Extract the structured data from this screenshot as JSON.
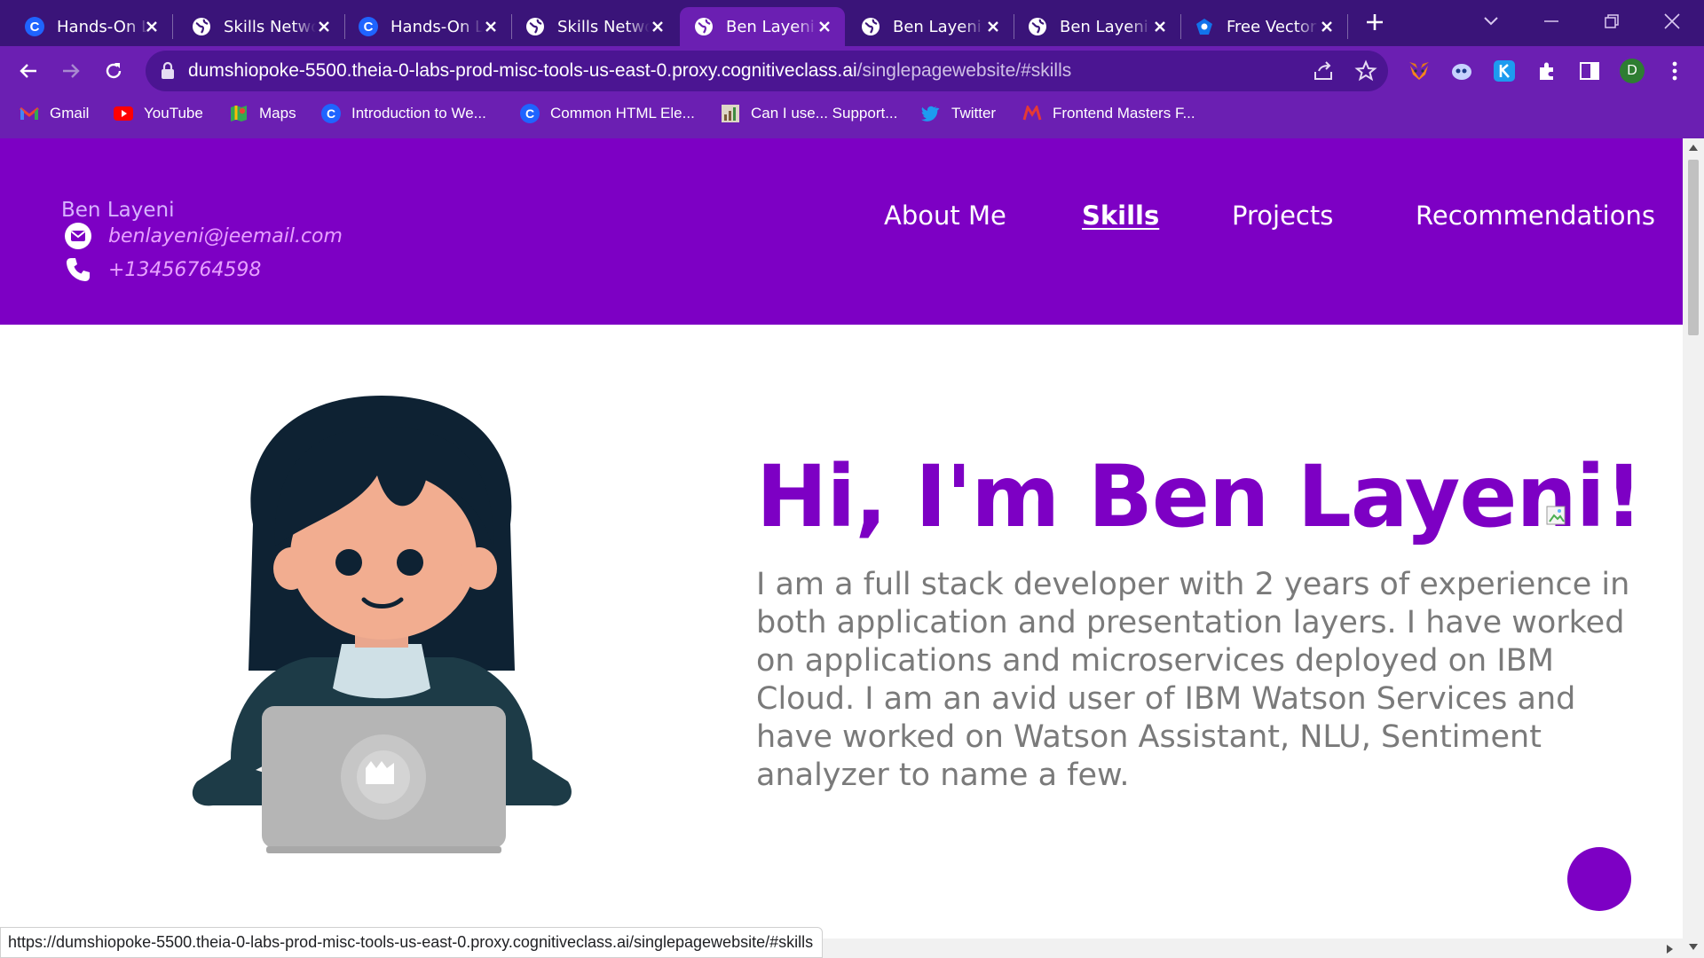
{
  "browser": {
    "tabs": [
      {
        "title": "Hands-On L",
        "favicon": "cognitiveclass-c-icon",
        "active": false
      },
      {
        "title": "Skills Netwo",
        "favicon": "globe-icon",
        "active": false
      },
      {
        "title": "Hands-On L",
        "favicon": "cognitiveclass-c-icon",
        "active": false
      },
      {
        "title": "Skills Netwo",
        "favicon": "globe-icon",
        "active": false
      },
      {
        "title": "Ben Layeni",
        "favicon": "globe-icon",
        "active": true
      },
      {
        "title": "Ben Layeni",
        "favicon": "globe-icon",
        "active": false
      },
      {
        "title": "Ben Layeni",
        "favicon": "globe-icon",
        "active": false
      },
      {
        "title": "Free Vector",
        "favicon": "freepik-icon",
        "active": false
      }
    ],
    "address_bar": {
      "host": "dumshiopoke-5500.theia-0-labs-prod-misc-tools-us-east-0.proxy.cognitiveclass.ai",
      "path": "/singlepagewebsite/#skills"
    },
    "bookmarks": [
      {
        "label": "Gmail",
        "icon": "gmail-icon"
      },
      {
        "label": "YouTube",
        "icon": "youtube-icon"
      },
      {
        "label": "Maps",
        "icon": "maps-icon"
      },
      {
        "label": "Introduction to We...",
        "icon": "cognitiveclass-c-icon"
      },
      {
        "label": "Common HTML Ele...",
        "icon": "cognitiveclass-c-icon"
      },
      {
        "label": "Can I use... Support...",
        "icon": "caniuse-icon"
      },
      {
        "label": "Twitter",
        "icon": "twitter-icon"
      },
      {
        "label": "Frontend Masters F...",
        "icon": "frontendmasters-icon"
      }
    ],
    "profile_initial": "D",
    "status_url": "https://dumshiopoke-5500.theia-0-labs-prod-misc-tools-us-east-0.proxy.cognitiveclass.ai/singlepagewebsite/#skills"
  },
  "site": {
    "header": {
      "name": "Ben Layeni",
      "email": "benlayeni@jeemail.com",
      "phone": "+13456764598",
      "nav": [
        {
          "label": "About Me",
          "active": false
        },
        {
          "label": "Skills",
          "active": true
        },
        {
          "label": "Projects",
          "active": false
        },
        {
          "label": "Recommendations",
          "active": false
        }
      ]
    },
    "hero": {
      "title": "Hi, I'm Ben Layeni!",
      "bio": "I am a full stack developer with 2 years of experience in both application and presentation layers. I have worked on applications and microservices deployed on IBM Cloud. I am an avid user of IBM Watson Services and have worked on Watson Assistant, NLU, Sentiment analyzer to name a few."
    }
  },
  "colors": {
    "tab_strip": "#3a1479",
    "toolbar": "#6b1fb2",
    "site_header": "#7d00c4",
    "title_purple": "#7d00c4",
    "bio_gray": "#7a7a7a"
  }
}
